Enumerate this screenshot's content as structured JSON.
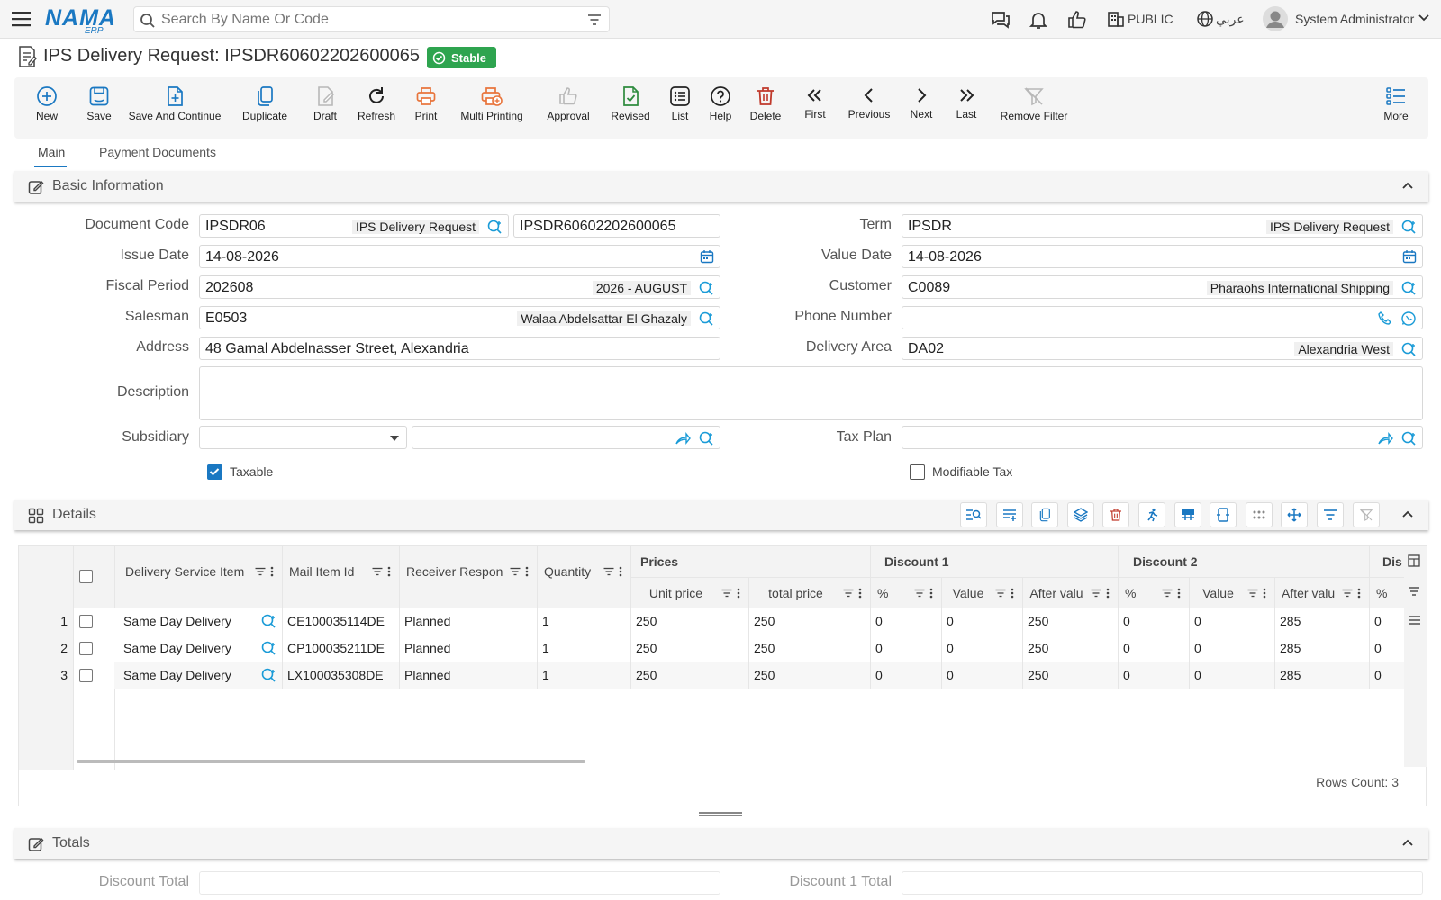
{
  "app": {
    "logo_main": "NAMA",
    "logo_sub": "ERP",
    "search_placeholder": "Search By Name Or Code",
    "public_label": "PUBLIC",
    "lang_label": "عربي",
    "user_name": "System Administrator"
  },
  "page": {
    "title": "IPS Delivery Request: IPSDR60602202600065",
    "status": "Stable"
  },
  "toolbar": {
    "buttons": [
      {
        "label": "New",
        "icon": "plus-circle-icon",
        "color": "#1a78c2"
      },
      {
        "label": "Save",
        "icon": "save-icon",
        "color": "#1a78c2"
      },
      {
        "label": "Save And Continue",
        "icon": "file-plus-icon",
        "color": "#1a78c2"
      },
      {
        "label": "Duplicate",
        "icon": "copy-icon",
        "color": "#1a78c2"
      },
      {
        "label": "Draft",
        "icon": "draft-icon",
        "color": "#b8b8b8"
      },
      {
        "label": "Refresh",
        "icon": "refresh-icon",
        "color": "#222222"
      },
      {
        "label": "Print",
        "icon": "printer-icon",
        "color": "#e8743b"
      },
      {
        "label": "Multi Printing",
        "icon": "multi-printer-icon",
        "color": "#e8743b"
      },
      {
        "label": "Approval",
        "icon": "thumbs-up-icon",
        "color": "#b8b8b8"
      },
      {
        "label": "Revised",
        "icon": "file-check-icon",
        "color": "#2e8b3e"
      },
      {
        "label": "List",
        "icon": "list-icon",
        "color": "#222222"
      },
      {
        "label": "Help",
        "icon": "help-icon",
        "color": "#222222"
      },
      {
        "label": "Delete",
        "icon": "trash-icon",
        "color": "#c0392b"
      },
      {
        "label": "First",
        "icon": "chevrons-left-icon",
        "color": "#222222"
      },
      {
        "label": "Previous",
        "icon": "chevron-left-icon",
        "color": "#222222"
      },
      {
        "label": "Next",
        "icon": "chevron-right-icon",
        "color": "#222222"
      },
      {
        "label": "Last",
        "icon": "chevrons-right-icon",
        "color": "#222222"
      },
      {
        "label": "Remove Filter",
        "icon": "filter-off-icon",
        "color": "#b8b8b8"
      },
      {
        "label": "More",
        "icon": "more-list-icon",
        "color": "#1a78c2"
      }
    ]
  },
  "tabs": [
    "Main",
    "Payment Documents"
  ],
  "basic": {
    "header": "Basic Information",
    "document_code_label": "Document Code",
    "document_code": "IPSDR06",
    "document_code_hint": "IPS Delivery Request",
    "document_number": "IPSDR60602202600065",
    "term_label": "Term",
    "term": "IPSDR",
    "term_hint": "IPS Delivery Request",
    "issue_date_label": "Issue Date",
    "issue_date": "14-08-2026",
    "value_date_label": "Value Date",
    "value_date": "14-08-2026",
    "fiscal_period_label": "Fiscal Period",
    "fiscal_period": "202608",
    "fiscal_period_hint": "2026 - AUGUST",
    "customer_label": "Customer",
    "customer": "C0089",
    "customer_hint": "Pharaohs International Shipping",
    "salesman_label": "Salesman",
    "salesman": "E0503",
    "salesman_hint": "Walaa Abdelsattar El Ghazaly",
    "phone_label": "Phone Number",
    "phone": "",
    "address_label": "Address",
    "address": "48 Gamal Abdelnasser Street, Alexandria",
    "delivery_area_label": "Delivery Area",
    "delivery_area": "DA02",
    "delivery_area_hint": "Alexandria West",
    "description_label": "Description",
    "description": "",
    "subsidiary_label": "Subsidiary",
    "tax_plan_label": "Tax Plan",
    "taxable_label": "Taxable",
    "taxable": true,
    "modifiable_tax_label": "Modifiable Tax",
    "modifiable_tax": false
  },
  "details": {
    "header": "Details",
    "group_headers": [
      "Prices",
      "Discount 1",
      "Discount 2",
      "Dis"
    ],
    "columns": [
      "Delivery Service Item",
      "Mail Item Id",
      "Receiver Respon",
      "Quantity",
      "Unit price",
      "total price",
      "%",
      "Value",
      "After valu",
      "%",
      "Value",
      "After valu",
      "%"
    ],
    "rows": [
      {
        "n": "1",
        "item": "Same Day Delivery",
        "mail_id": "CE100035114DE",
        "receiver": "Planned",
        "qty": "1",
        "unit": "250",
        "total": "250",
        "d1p": "0",
        "d1v": "0",
        "d1a": "250",
        "d2p": "0",
        "d2v": "0",
        "d2a": "285",
        "d3p": "0"
      },
      {
        "n": "2",
        "item": "Same Day Delivery",
        "mail_id": "CP100035211DE",
        "receiver": "Planned",
        "qty": "1",
        "unit": "250",
        "total": "250",
        "d1p": "0",
        "d1v": "0",
        "d1a": "250",
        "d2p": "0",
        "d2v": "0",
        "d2a": "285",
        "d3p": "0"
      },
      {
        "n": "3",
        "item": "Same Day Delivery",
        "mail_id": "LX100035308DE",
        "receiver": "Planned",
        "qty": "1",
        "unit": "250",
        "total": "250",
        "d1p": "0",
        "d1v": "0",
        "d1a": "250",
        "d2p": "0",
        "d2v": "0",
        "d2a": "285",
        "d3p": "0"
      }
    ],
    "rows_count": "Rows Count: 3"
  },
  "totals": {
    "header": "Totals",
    "discount_total_label": "Discount Total",
    "discount1_total_label": "Discount 1 Total"
  },
  "colors": {
    "accent": "#1a78c2",
    "success": "#2ea44f",
    "danger": "#c0392b",
    "print": "#e8743b"
  }
}
